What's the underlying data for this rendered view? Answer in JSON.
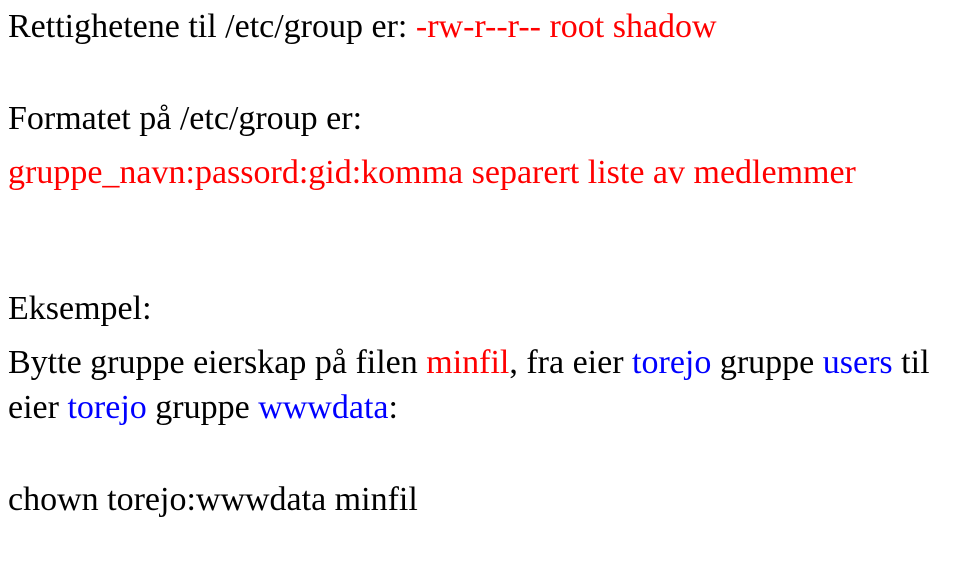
{
  "line1": {
    "t1": "Rettighetene til /etc/group er:  ",
    "t2": "-rw-r--r--  root  shadow"
  },
  "line2": {
    "t1": "Formatet på /etc/group er:"
  },
  "line3": {
    "t1": "gruppe_navn:passord:gid:komma separert liste av medlemmer"
  },
  "line4": {
    "t1": "Eksempel:"
  },
  "line5": {
    "t1": "Bytte gruppe eierskap på filen ",
    "t2": "minfil",
    "t3": ", fra eier ",
    "t4": "torejo",
    "t5": " gruppe ",
    "t6": "users",
    "t7": " til eier ",
    "t8": "torejo",
    "t9": " gruppe ",
    "t10": "wwwdata",
    "t11": ":"
  },
  "line6": {
    "t1": "chown torejo:wwwdata minfil"
  }
}
